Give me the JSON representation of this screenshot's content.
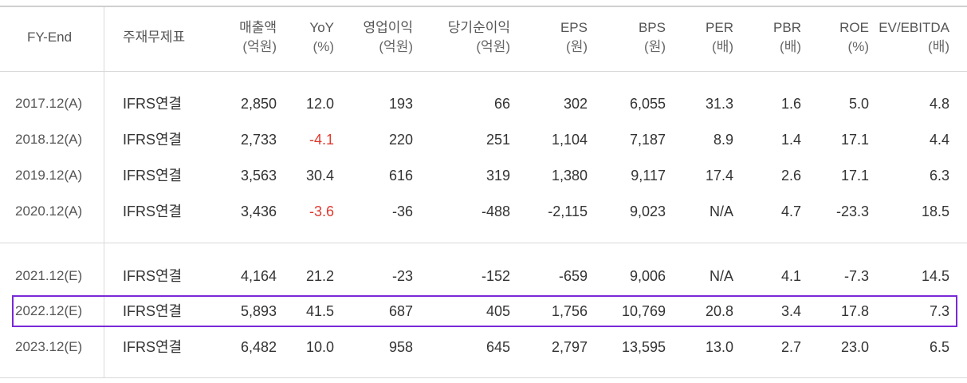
{
  "headers": [
    {
      "key": "fy",
      "line1": "FY-End",
      "line2": ""
    },
    {
      "key": "type",
      "line1": "주재무제표",
      "line2": ""
    },
    {
      "key": "sales",
      "line1": "매출액",
      "line2": "(억원)"
    },
    {
      "key": "yoy",
      "line1": "YoY",
      "line2": "(%)"
    },
    {
      "key": "op",
      "line1": "영업이익",
      "line2": "(억원)"
    },
    {
      "key": "net",
      "line1": "당기순이익",
      "line2": "(억원)"
    },
    {
      "key": "eps",
      "line1": "EPS",
      "line2": "(원)"
    },
    {
      "key": "bps",
      "line1": "BPS",
      "line2": "(원)"
    },
    {
      "key": "per",
      "line1": "PER",
      "line2": "(배)"
    },
    {
      "key": "pbr",
      "line1": "PBR",
      "line2": "(배)"
    },
    {
      "key": "roe",
      "line1": "ROE",
      "line2": "(%)"
    },
    {
      "key": "ev",
      "line1": "EV/EBITDA",
      "line2": "(배)"
    }
  ],
  "rows": [
    {
      "fy": "2017.12(A)",
      "type": "IFRS연결",
      "sales": "2,850",
      "yoy": "12.0",
      "op": "193",
      "net": "66",
      "eps": "302",
      "bps": "6,055",
      "per": "31.3",
      "pbr": "1.6",
      "roe": "5.0",
      "ev": "4.8"
    },
    {
      "fy": "2018.12(A)",
      "type": "IFRS연결",
      "sales": "2,733",
      "yoy": "-4.1",
      "op": "220",
      "net": "251",
      "eps": "1,104",
      "bps": "7,187",
      "per": "8.9",
      "pbr": "1.4",
      "roe": "17.1",
      "ev": "4.4"
    },
    {
      "fy": "2019.12(A)",
      "type": "IFRS연결",
      "sales": "3,563",
      "yoy": "30.4",
      "op": "616",
      "net": "319",
      "eps": "1,380",
      "bps": "9,117",
      "per": "17.4",
      "pbr": "2.6",
      "roe": "17.1",
      "ev": "6.3"
    },
    {
      "fy": "2020.12(A)",
      "type": "IFRS연결",
      "sales": "3,436",
      "yoy": "-3.6",
      "op": "-36",
      "net": "-488",
      "eps": "-2,115",
      "bps": "9,023",
      "per": "N/A",
      "pbr": "4.7",
      "roe": "-23.3",
      "ev": "18.5"
    },
    {
      "fy": "2021.12(E)",
      "type": "IFRS연결",
      "sales": "4,164",
      "yoy": "21.2",
      "op": "-23",
      "net": "-152",
      "eps": "-659",
      "bps": "9,006",
      "per": "N/A",
      "pbr": "4.1",
      "roe": "-7.3",
      "ev": "14.5"
    },
    {
      "fy": "2022.12(E)",
      "type": "IFRS연결",
      "sales": "5,893",
      "yoy": "41.5",
      "op": "687",
      "net": "405",
      "eps": "1,756",
      "bps": "10,769",
      "per": "20.8",
      "pbr": "3.4",
      "roe": "17.8",
      "ev": "7.3"
    },
    {
      "fy": "2023.12(E)",
      "type": "IFRS연결",
      "sales": "6,482",
      "yoy": "10.0",
      "op": "958",
      "net": "645",
      "eps": "2,797",
      "bps": "13,595",
      "per": "13.0",
      "pbr": "2.7",
      "roe": "23.0",
      "ev": "6.5"
    }
  ],
  "highlighted_row": "2022.12(E)",
  "colors": {
    "negative_yoy": "#e03a2f",
    "highlight_border": "#7a29d6"
  }
}
